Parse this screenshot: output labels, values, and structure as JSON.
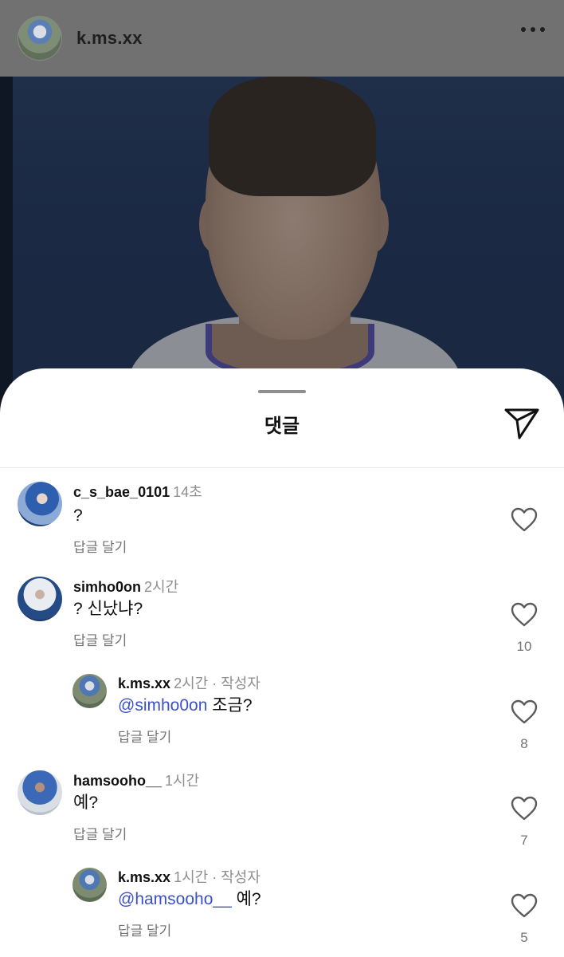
{
  "post": {
    "username": "k.ms.xx"
  },
  "sheet": {
    "title": "댓글"
  },
  "comments": [
    {
      "username": "c_s_bae_0101",
      "time": "14초",
      "author_tag": "",
      "mention": "",
      "text": "?",
      "reply_label": "답글 달기",
      "likes": ""
    },
    {
      "username": "simho0on",
      "time": "2시간",
      "author_tag": "",
      "mention": "",
      "text": "? 신났냐?",
      "reply_label": "답글 달기",
      "likes": "10"
    },
    {
      "username": "k.ms.xx",
      "time": "2시간",
      "author_tag": " · 작성자",
      "mention": "@simho0on",
      "text": " 조금?",
      "reply_label": "답글 달기",
      "likes": "8"
    },
    {
      "username": "hamsooho__",
      "time": "1시간",
      "author_tag": "",
      "mention": "",
      "text": "예?",
      "reply_label": "답글 달기",
      "likes": "7"
    },
    {
      "username": "k.ms.xx",
      "time": "1시간",
      "author_tag": " · 작성자",
      "mention": "@hamsooho__",
      "text": " 예?",
      "reply_label": "답글 달기",
      "likes": "5"
    }
  ],
  "icons": {
    "more": "more-dots-icon",
    "share": "send-icon",
    "like": "heart-icon"
  },
  "colors": {
    "mention": "#3b51c9",
    "muted": "#8e8e8e",
    "overlay": "#717171"
  }
}
